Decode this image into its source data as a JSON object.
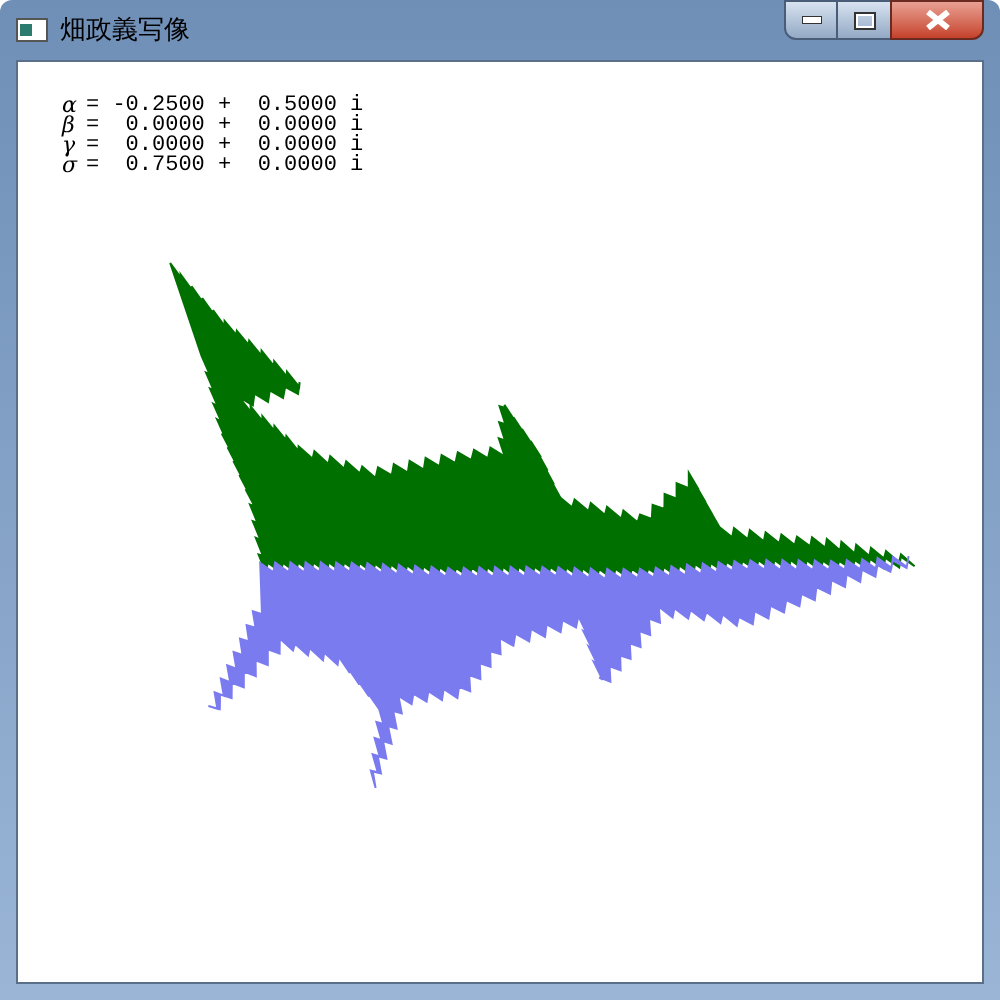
{
  "window": {
    "title": "畑政義写像"
  },
  "parameters": [
    {
      "symbol": "α",
      "text": "= -0.2500 +  0.5000 i"
    },
    {
      "symbol": "β",
      "text": "=  0.0000 +  0.0000 i"
    },
    {
      "symbol": "γ",
      "text": "=  0.0000 +  0.0000 i"
    },
    {
      "symbol": "σ",
      "text": "=  0.7500 +  0.0000 i"
    }
  ]
}
